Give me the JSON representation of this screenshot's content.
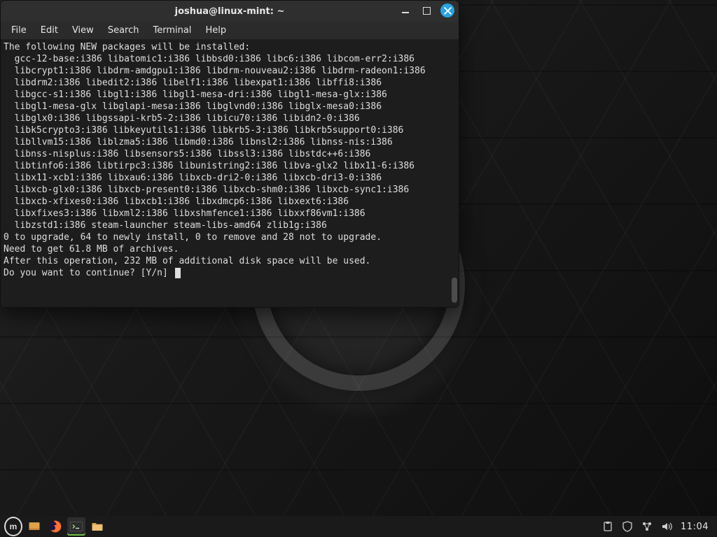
{
  "window": {
    "title": "joshua@linux-mint: ~",
    "menu": [
      "File",
      "Edit",
      "View",
      "Search",
      "Terminal",
      "Help"
    ],
    "buttons": {
      "min": "minimize",
      "max": "maximize",
      "close": "close"
    }
  },
  "terminal": {
    "lines": [
      "The following NEW packages will be installed:",
      "  gcc-12-base:i386 libatomic1:i386 libbsd0:i386 libc6:i386 libcom-err2:i386",
      "  libcrypt1:i386 libdrm-amdgpu1:i386 libdrm-nouveau2:i386 libdrm-radeon1:i386",
      "  libdrm2:i386 libedit2:i386 libelf1:i386 libexpat1:i386 libffi8:i386",
      "  libgcc-s1:i386 libgl1:i386 libgl1-mesa-dri:i386 libgl1-mesa-glx:i386",
      "  libgl1-mesa-glx libglapi-mesa:i386 libglvnd0:i386 libglx-mesa0:i386",
      "  libglx0:i386 libgssapi-krb5-2:i386 libicu70:i386 libidn2-0:i386",
      "  libk5crypto3:i386 libkeyutils1:i386 libkrb5-3:i386 libkrb5support0:i386",
      "  libllvm15:i386 liblzma5:i386 libmd0:i386 libnsl2:i386 libnss-nis:i386",
      "  libnss-nisplus:i386 libsensors5:i386 libssl3:i386 libstdc++6:i386",
      "  libtinfo6:i386 libtirpc3:i386 libunistring2:i386 libva-glx2 libx11-6:i386",
      "  libx11-xcb1:i386 libxau6:i386 libxcb-dri2-0:i386 libxcb-dri3-0:i386",
      "  libxcb-glx0:i386 libxcb-present0:i386 libxcb-shm0:i386 libxcb-sync1:i386",
      "  libxcb-xfixes0:i386 libxcb1:i386 libxdmcp6:i386 libxext6:i386",
      "  libxfixes3:i386 libxml2:i386 libxshmfence1:i386 libxxf86vm1:i386",
      "  libzstd1:i386 steam-launcher steam-libs-amd64 zlib1g:i386",
      "0 to upgrade, 64 to newly install, 0 to remove and 28 not to upgrade.",
      "Need to get 61.8 MB of archives.",
      "After this operation, 232 MB of additional disk space will be used.",
      "Do you want to continue? [Y/n] "
    ]
  },
  "panel": {
    "launchers": [
      {
        "name": "menu",
        "icon": "mint-menu-icon"
      },
      {
        "name": "show-desktop",
        "icon": "show-desktop-icon"
      },
      {
        "name": "firefox",
        "icon": "firefox-icon"
      },
      {
        "name": "terminal",
        "icon": "terminal-icon",
        "active": true
      },
      {
        "name": "files",
        "icon": "files-icon"
      }
    ],
    "tray": [
      {
        "name": "clipboard",
        "icon": "clipboard-icon"
      },
      {
        "name": "firewall",
        "icon": "shield-icon"
      },
      {
        "name": "network",
        "icon": "network-icon"
      },
      {
        "name": "sound",
        "icon": "volume-icon"
      }
    ],
    "clock": "11:04"
  }
}
